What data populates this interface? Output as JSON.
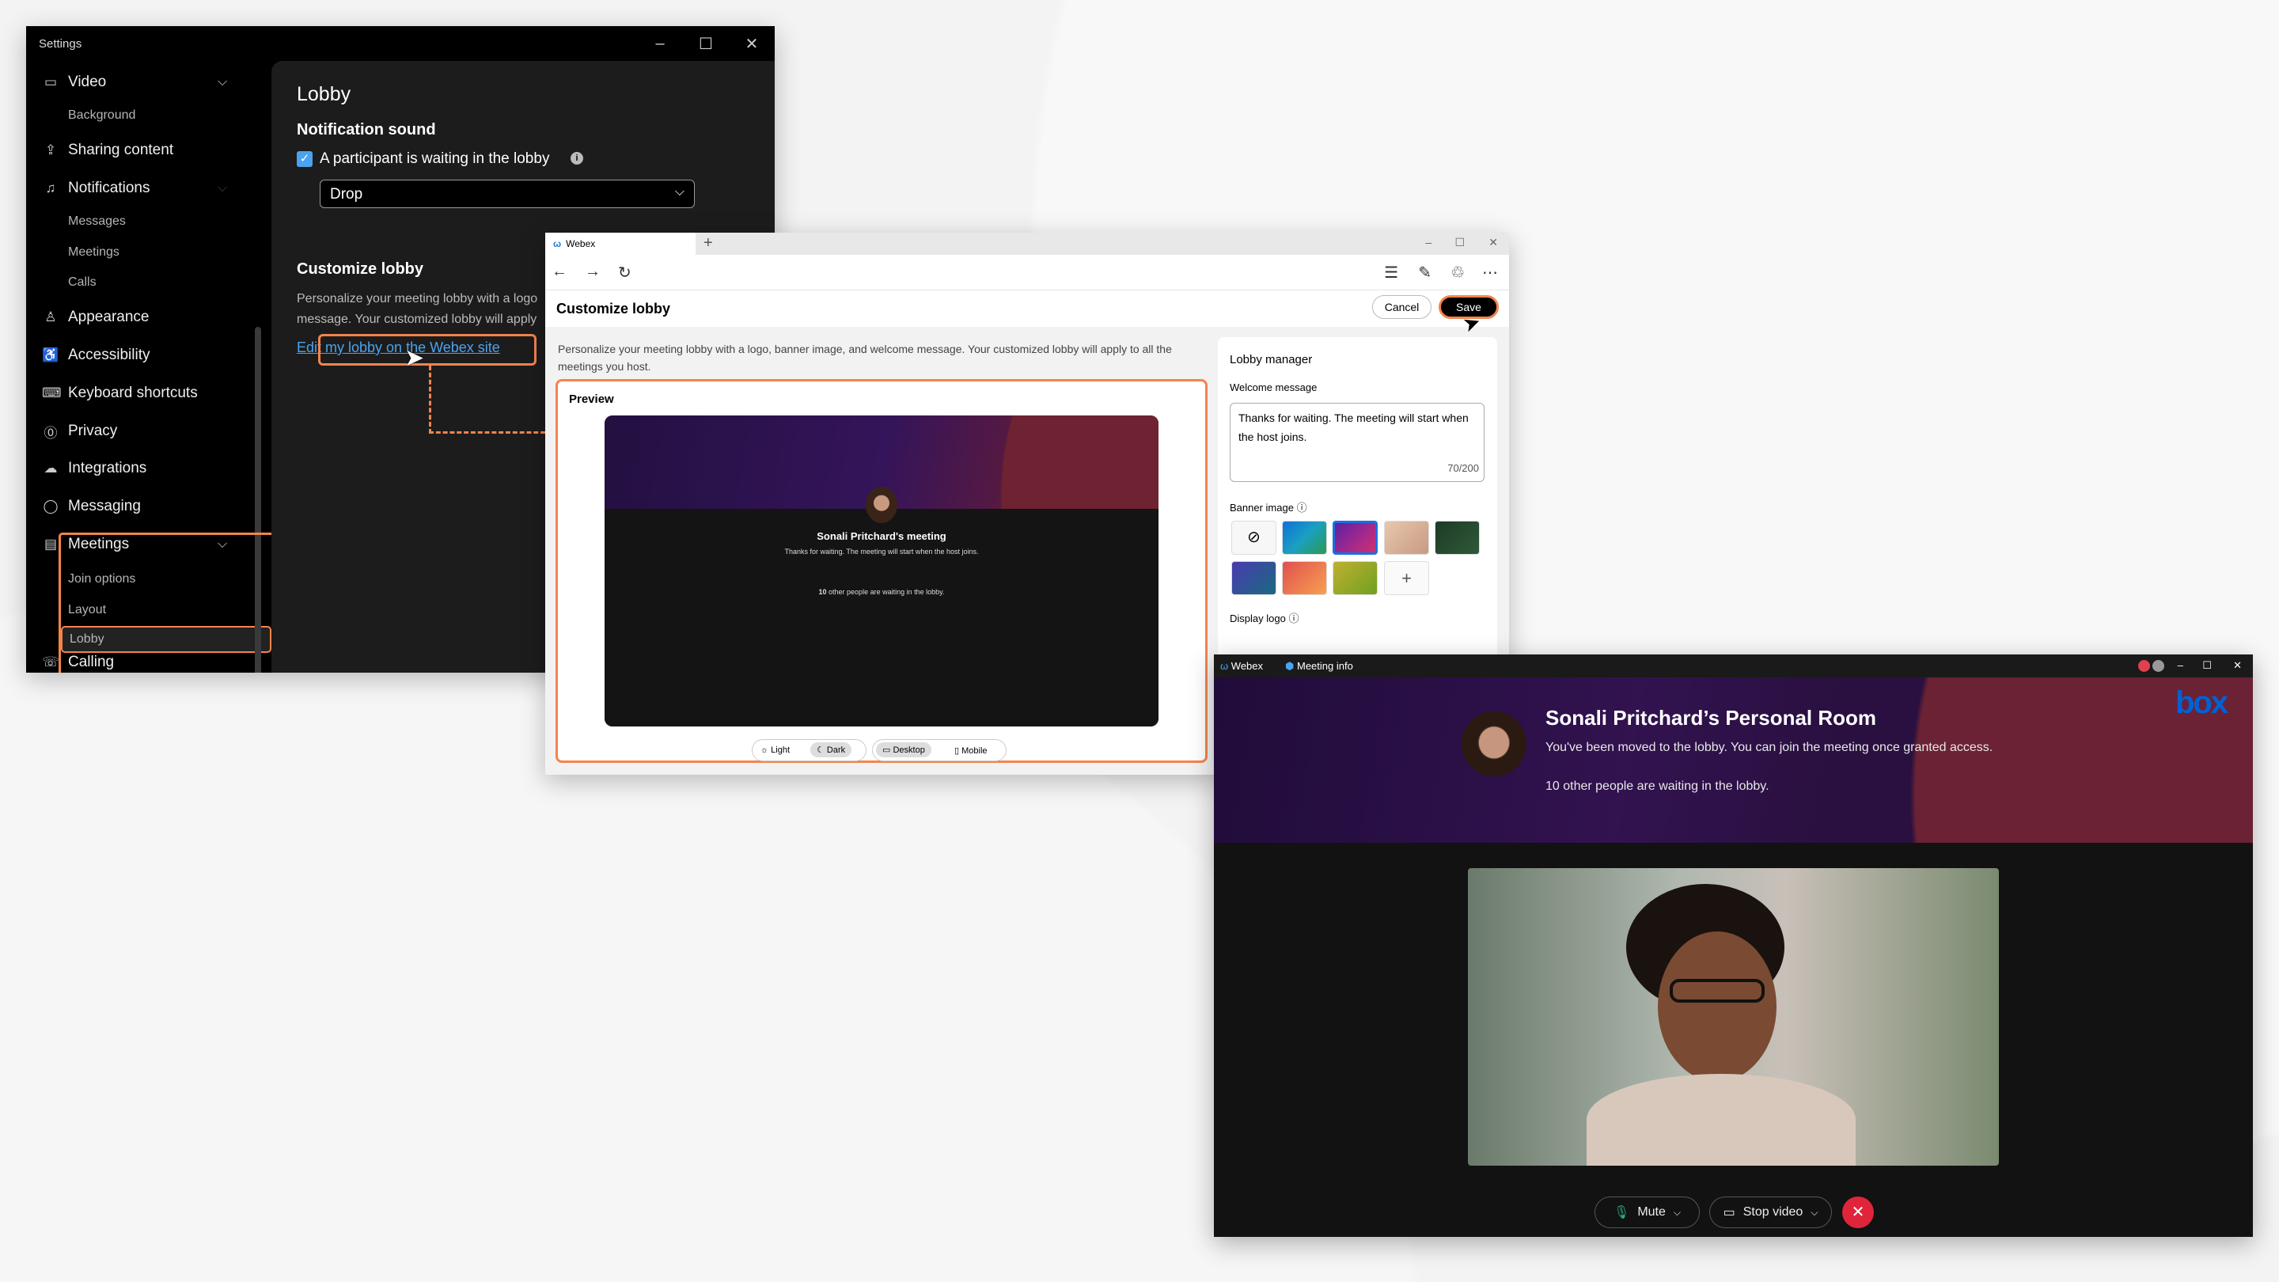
{
  "settings": {
    "title": "Settings",
    "sidebar": [
      {
        "label": "Video",
        "icon": "video-icon",
        "type": "main",
        "expanded": true
      },
      {
        "label": "Background",
        "type": "sub"
      },
      {
        "label": "Sharing content",
        "icon": "share-icon",
        "type": "main"
      },
      {
        "label": "Notifications",
        "icon": "bell-icon",
        "type": "main"
      },
      {
        "label": "Messages",
        "type": "sub"
      },
      {
        "label": "Meetings",
        "type": "sub"
      },
      {
        "label": "Calls",
        "type": "sub"
      },
      {
        "label": "Appearance",
        "icon": "paint-icon",
        "type": "main"
      },
      {
        "label": "Accessibility",
        "icon": "accessibility-icon",
        "type": "main"
      },
      {
        "label": "Keyboard shortcuts",
        "icon": "keyboard-icon",
        "type": "main"
      },
      {
        "label": "Privacy",
        "icon": "privacy-icon",
        "type": "main"
      },
      {
        "label": "Integrations",
        "icon": "cloud-icon",
        "type": "main"
      },
      {
        "label": "Messaging",
        "icon": "chat-icon",
        "type": "main"
      },
      {
        "label": "Meetings",
        "icon": "calendar-icon",
        "type": "main",
        "expanded": true
      },
      {
        "label": "Join options",
        "type": "sub"
      },
      {
        "label": "Layout",
        "type": "sub"
      },
      {
        "label": "Lobby",
        "type": "sub",
        "selected": true
      },
      {
        "label": "Calling",
        "icon": "phone-icon",
        "type": "main"
      }
    ],
    "content": {
      "title": "Lobby",
      "notification_heading": "Notification sound",
      "checkbox_label": "A participant is waiting in the lobby",
      "checkbox_checked": true,
      "sound_value": "Drop",
      "customize_heading": "Customize lobby",
      "customize_desc_1": "Personalize your meeting lobby with a logo",
      "customize_desc_2": "message. Your customized lobby will apply",
      "edit_link": "Edit my lobby on the Webex site"
    }
  },
  "browser": {
    "tab_title": "Webex",
    "page_title": "Customize lobby",
    "cancel": "Cancel",
    "save": "Save",
    "description": "Personalize your meeting lobby with a logo, banner image, and welcome message. Your customized lobby will apply to all the meetings you host.",
    "preview": {
      "label": "Preview",
      "meeting_title": "Sonali Pritchard's meeting",
      "welcome": "Thanks for waiting. The meeting will start when the host joins.",
      "waiting_count": "10",
      "waiting_text": " other people are waiting in the lobby.",
      "modes": [
        "Light",
        "Dark"
      ],
      "devices": [
        "Desktop",
        "Mobile"
      ],
      "selected_mode": "Dark",
      "selected_device": "Desktop"
    },
    "lobby_manager": {
      "title": "Lobby manager",
      "welcome_label": "Welcome message",
      "welcome_value": "Thanks for waiting. The meeting will start when the host joins.",
      "char_count": "70/200",
      "banner_label": "Banner image",
      "display_logo_label": "Display logo",
      "banner_swatches": [
        "none",
        "#1f8fd0",
        "#7a2ca8",
        "#d9b59a",
        "#2a4a32",
        "#3a4fb0",
        "#f07050",
        "#a8c030"
      ]
    }
  },
  "meeting": {
    "app": "Webex",
    "meeting_info": "Meeting info",
    "title": "Sonali Pritchard’s Personal Room",
    "subtitle": "You've been moved to the lobby. You can join the meeting once granted access.",
    "waiting": "10 other people are waiting in the lobby.",
    "logo": "box",
    "mute": "Mute",
    "stop_video": "Stop video"
  },
  "colors": {
    "highlight": "#f5844c",
    "link": "#4aa3f0",
    "accent_blue": "#0061d5",
    "end_red": "#e0253a"
  }
}
